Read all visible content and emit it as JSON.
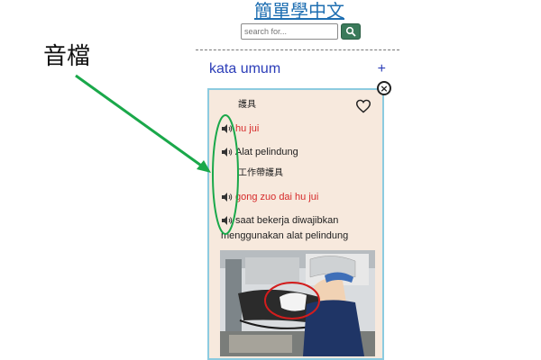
{
  "site": {
    "title": "簡單學中文"
  },
  "search": {
    "placeholder": "search for..."
  },
  "category": {
    "label": "kata umum",
    "expand": "+"
  },
  "card": {
    "close": "×",
    "headword": "護具",
    "pinyin": "hu jui",
    "meaning": "Alat pelindung",
    "example_cjk": "工作帶護具",
    "example_pinyin": "gong zuo dai hu jui",
    "example_meaning_1": "saat bekerja diwajibkan",
    "example_meaning_2": "menggunakan alat pelindung"
  },
  "annotation": {
    "label": "音檔"
  },
  "colors": {
    "title": "#1f6fb2",
    "pinyin": "#d62a2a",
    "category": "#2b3db8",
    "arrow": "#1aa84a",
    "card_bg": "#f7e9dd",
    "card_border": "#8ccbe0"
  },
  "icons": [
    "search-icon",
    "speaker-icon",
    "heart-icon",
    "close-icon"
  ]
}
